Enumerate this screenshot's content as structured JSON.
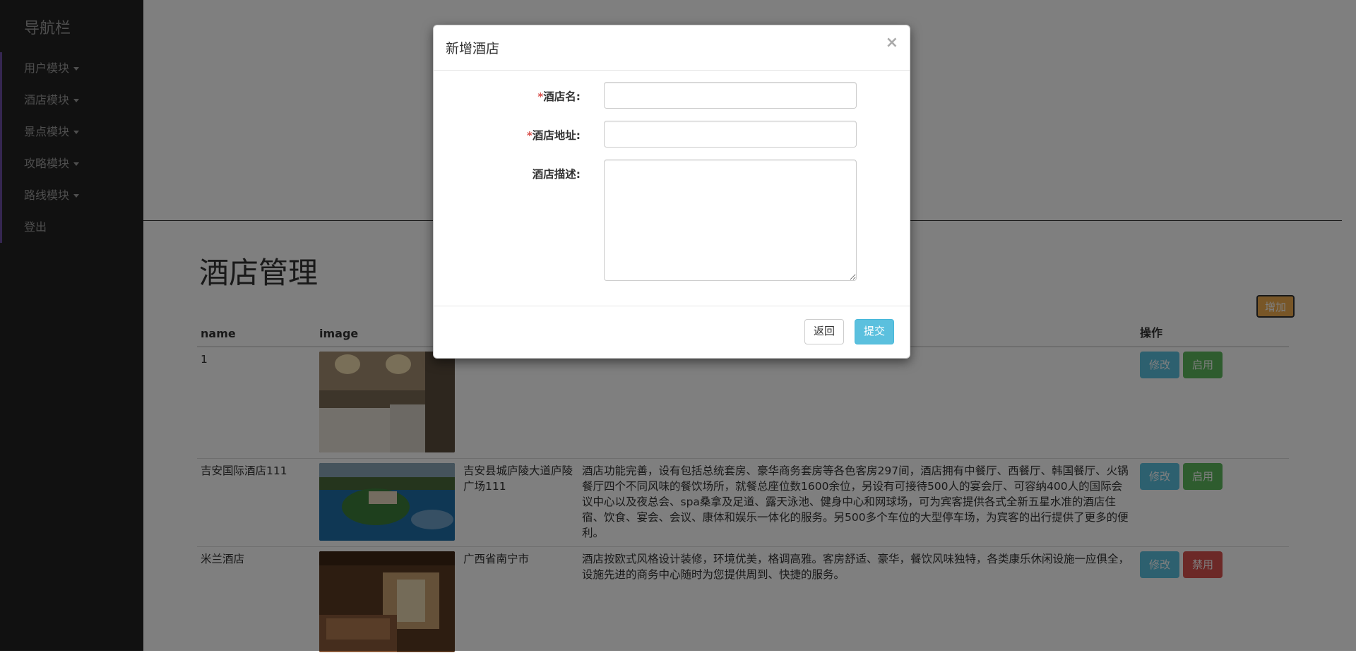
{
  "sidebar": {
    "brand": "导航栏",
    "items": [
      {
        "label": "用户模块"
      },
      {
        "label": "酒店模块"
      },
      {
        "label": "景点模块"
      },
      {
        "label": "攻略模块"
      },
      {
        "label": "路线模块"
      },
      {
        "label": "登出"
      }
    ]
  },
  "main": {
    "title": "酒店管理",
    "add_label": "增加",
    "table": {
      "headers": [
        "name",
        "image",
        "",
        "",
        "操作"
      ],
      "rows": [
        {
          "name": "1",
          "address": "",
          "description": "",
          "edit": "修改",
          "toggle": "启用",
          "toggle_type": "success",
          "image_colors": [
            "#7b6b55",
            "#e6e0d6",
            "#bcb5aa"
          ]
        },
        {
          "name": "吉安国际酒店111",
          "address": "吉安县城庐陵大道庐陵广场111",
          "description": "酒店功能完善，设有包括总统套房、豪华商务套房等各色客房297间，酒店拥有中餐厅、西餐厅、韩国餐厅、火锅餐厅四个不同风味的餐饮场所，就餐总座位数1600余位，另设有可接待500人的宴会厅、可容纳400人的国际会议中心以及夜总会、spa桑拿及足道、露天泳池、健身中心和网球场，可为宾客提供各式全新五星水准的酒店住宿、饮食、宴会、会议、康体和娱乐一体化的服务。另500多个车位的大型停车场，为宾客的出行提供了更多的便利。",
          "edit": "修改",
          "toggle": "启用",
          "toggle_type": "success",
          "image_colors": [
            "#1e6fa8",
            "#3d7f3a",
            "#6ea0c8"
          ]
        },
        {
          "name": "米兰酒店",
          "address": "广西省南宁市",
          "description": "酒店按欧式风格设计装修，环境优美，格调高雅。客房舒适、豪华，餐饮风味独特，各类康乐休闲设施一应俱全，设施先进的商务中心随时为您提供周到、快捷的服务。",
          "edit": "修改",
          "toggle": "禁用",
          "toggle_type": "danger",
          "image_colors": [
            "#5a3a22",
            "#c9a070",
            "#8a5a3a"
          ]
        }
      ]
    }
  },
  "modal": {
    "title": "新增酒店",
    "close": "×",
    "fields": [
      {
        "required": true,
        "label": "酒店名:",
        "value": ""
      },
      {
        "required": true,
        "label": "酒店地址:",
        "value": ""
      },
      {
        "required": false,
        "label": "酒店描述:",
        "value": ""
      }
    ],
    "back_label": "返回",
    "submit_label": "提交"
  },
  "colors": {
    "overlay": "rgba(0,0,0,0.5)",
    "info": "#5bc0de",
    "success": "#5cb85c",
    "danger": "#d9534f",
    "warning": "#f0ad4e"
  }
}
